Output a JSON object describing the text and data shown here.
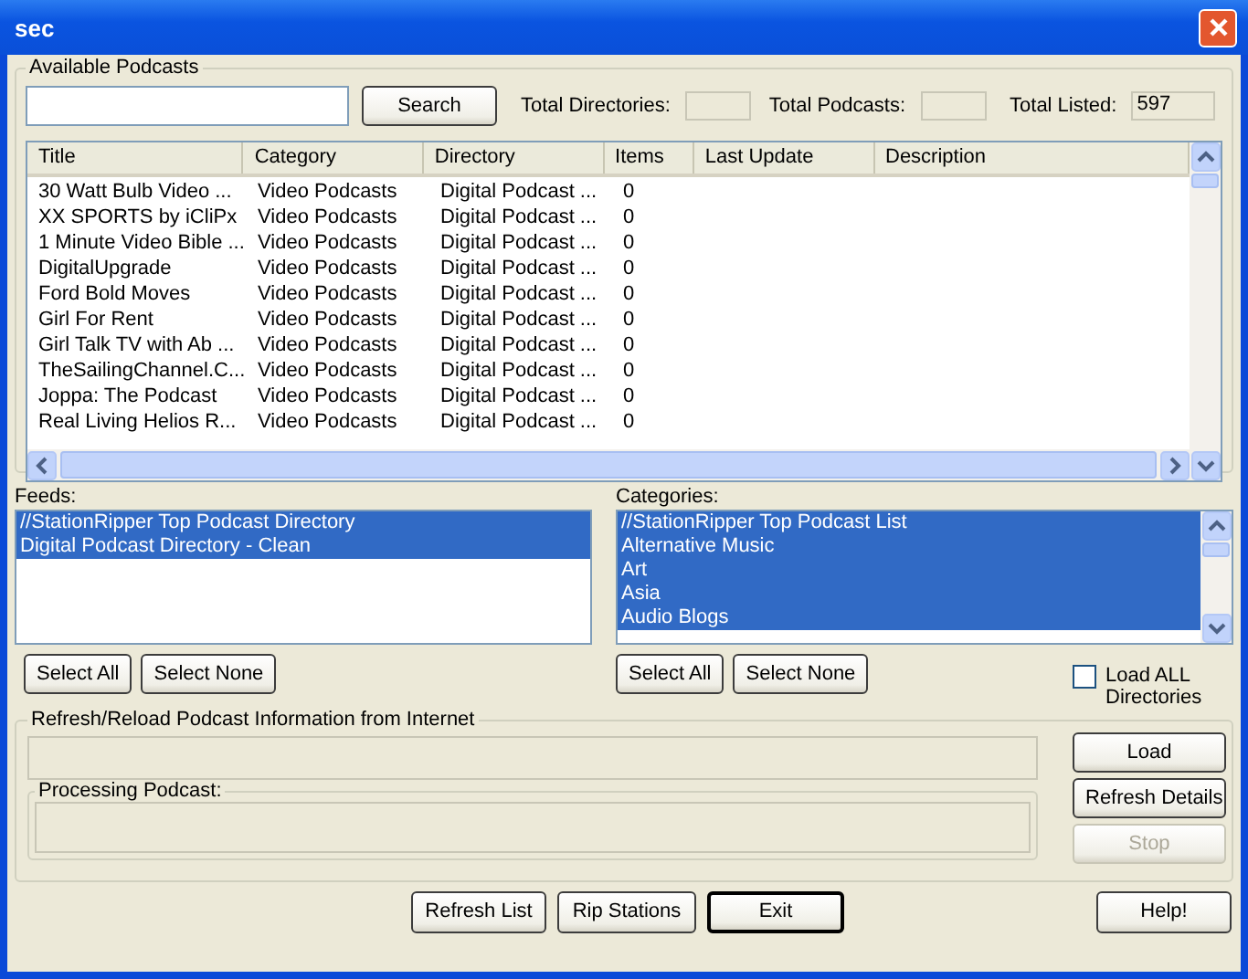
{
  "window": {
    "title": "sec"
  },
  "available": {
    "title": "Available Podcasts",
    "search": {
      "button": "Search"
    },
    "stats": [
      {
        "label": "Total Directories:"
      },
      {
        "label": "Total Podcasts:"
      },
      {
        "label": "Total Listed:",
        "value": "597"
      }
    ],
    "table": {
      "columns": [
        "Title",
        "Category",
        "Directory",
        "Items",
        "Last Update",
        "Description"
      ],
      "rows": [
        [
          "30 Watt Bulb Video ...",
          "Video Podcasts",
          "Digital Podcast ...",
          "0"
        ],
        [
          "XX SPORTS by iCliPx",
          "Video Podcasts",
          "Digital Podcast ...",
          "0"
        ],
        [
          "1 Minute Video Bible ...",
          "Video Podcasts",
          "Digital Podcast ...",
          "0"
        ],
        [
          "DigitalUpgrade",
          "Video Podcasts",
          "Digital Podcast ...",
          "0"
        ],
        [
          "Ford Bold Moves",
          "Video Podcasts",
          "Digital Podcast ...",
          "0"
        ],
        [
          "Girl For Rent",
          "Video Podcasts",
          "Digital Podcast ...",
          "0"
        ],
        [
          "Girl Talk TV with Ab ...",
          "Video Podcasts",
          "Digital Podcast ...",
          "0"
        ],
        [
          "TheSailingChannel.C...",
          "Video Podcasts",
          "Digital Podcast ...",
          "0"
        ],
        [
          "Joppa: The Podcast",
          "Video Podcasts",
          "Digital Podcast ...",
          "0"
        ],
        [
          "Real Living Helios R...",
          "Video Podcasts",
          "Digital Podcast ...",
          "0"
        ]
      ]
    }
  },
  "feeds": {
    "label": "Feeds:",
    "items": [
      {
        "label": "//StationRipper Top Podcast Directory",
        "selected": true
      },
      {
        "label": "Digital Podcast Directory - Clean",
        "selected": true
      }
    ],
    "buttons": [
      "Select All",
      "Select None"
    ]
  },
  "categories": {
    "label": "Categories:",
    "items": [
      {
        "label": "//StationRipper Top Podcast List",
        "selected": true
      },
      {
        "label": "Alternative Music",
        "selected": true
      },
      {
        "label": "Art",
        "selected": true
      },
      {
        "label": "Asia",
        "selected": true
      },
      {
        "label": "Audio Blogs",
        "selected": true
      }
    ],
    "buttons": [
      "Select All",
      "Select None"
    ]
  },
  "load_all": {
    "label": "Load ALL Directories",
    "checked": false
  },
  "refresh": {
    "title": "Refresh/Reload Podcast Information from Internet",
    "processing_label": "Processing Podcast:",
    "progress": {
      "level": 0
    },
    "buttons": [
      {
        "label": "Load",
        "disabled": false
      },
      {
        "label": "Refresh Details",
        "disabled": false
      },
      {
        "label": "Stop",
        "disabled": true
      }
    ]
  },
  "footer": {
    "buttons": [
      {
        "label": "Refresh List",
        "default": false
      },
      {
        "label": "Rip Stations",
        "default": false
      },
      {
        "label": "Exit",
        "default": true
      }
    ],
    "help": "Help!"
  }
}
